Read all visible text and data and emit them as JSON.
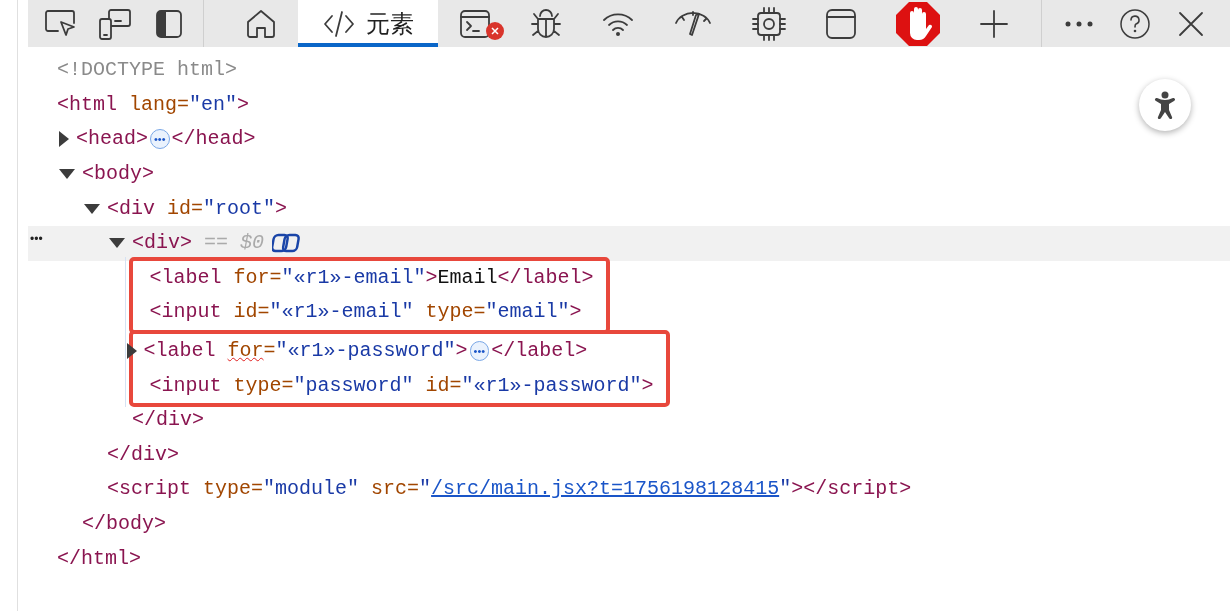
{
  "toolbar": {
    "left_tools": [
      {
        "kind": "cursor"
      },
      {
        "kind": "devices"
      },
      {
        "kind": "panel"
      }
    ],
    "tabs": [
      {
        "kind": "home",
        "selected": false
      },
      {
        "kind": "code",
        "label": "元素",
        "selected": true
      },
      {
        "kind": "terminal",
        "selected": false,
        "error_badge": true
      },
      {
        "kind": "bug",
        "selected": false
      },
      {
        "kind": "wifi",
        "selected": false
      },
      {
        "kind": "gauge",
        "selected": false
      },
      {
        "kind": "chip",
        "selected": false
      },
      {
        "kind": "window",
        "selected": false
      },
      {
        "kind": "stop_hand",
        "selected": false
      },
      {
        "kind": "plus",
        "selected": false
      }
    ],
    "actions": [
      {
        "kind": "more"
      },
      {
        "kind": "help"
      },
      {
        "kind": "close"
      }
    ]
  },
  "dom_tree": [
    {
      "tokens": [
        {
          "kind": "doctype",
          "text": "<!DOCTYPE html>"
        }
      ]
    },
    {
      "tokens": [
        {
          "kind": "tag",
          "text": "<html"
        },
        {
          "kind": "attr",
          "text": " lang="
        },
        {
          "kind": "value",
          "text": "\"en\""
        },
        {
          "kind": "tag",
          "text": ">"
        }
      ],
      "close_tokens": [
        {
          "kind": "tag",
          "text": "</html>"
        }
      ],
      "children": [
        {
          "expanded": false,
          "tokens": [
            {
              "kind": "tag",
              "text": "<head>"
            },
            {
              "kind": "collapsed",
              "text": "•••"
            },
            {
              "kind": "tag",
              "text": "</head>"
            }
          ]
        },
        {
          "expanded": true,
          "tokens": [
            {
              "kind": "tag",
              "text": "<body>"
            }
          ],
          "close_tokens": [
            {
              "kind": "tag",
              "text": "</body>"
            }
          ],
          "children": [
            {
              "expanded": true,
              "tokens": [
                {
                  "kind": "tag",
                  "text": "<div"
                },
                {
                  "kind": "attr",
                  "text": " id="
                },
                {
                  "kind": "value",
                  "text": "\"root\""
                },
                {
                  "kind": "tag",
                  "text": ">"
                }
              ],
              "close_tokens": [
                {
                  "kind": "tag",
                  "text": "</div>"
                }
              ],
              "children": [
                {
                  "expanded": true,
                  "selected": true,
                  "row_menu": "•••",
                  "tokens": [
                    {
                      "kind": "tag",
                      "text": "<div>"
                    },
                    {
                      "kind": "dim",
                      "text": " == $0"
                    },
                    {
                      "kind": "copilot_icon"
                    }
                  ],
                  "close_tokens": [
                    {
                      "kind": "tag",
                      "text": "</div>"
                    }
                  ],
                  "children": [
                    {
                      "kind": "outline",
                      "children": [
                        {
                          "tokens": [
                            {
                              "kind": "tag",
                              "text": "<label"
                            },
                            {
                              "kind": "attr",
                              "text": " for="
                            },
                            {
                              "kind": "value",
                              "text": "\"«r1»-email\""
                            },
                            {
                              "kind": "tag",
                              "text": ">"
                            },
                            {
                              "kind": "text",
                              "text": "Email"
                            },
                            {
                              "kind": "tag",
                              "text": "</label>"
                            }
                          ]
                        },
                        {
                          "tokens": [
                            {
                              "kind": "tag",
                              "text": "<input"
                            },
                            {
                              "kind": "attr",
                              "text": " id="
                            },
                            {
                              "kind": "value",
                              "text": "\"«r1»-email\""
                            },
                            {
                              "kind": "attr",
                              "text": " type="
                            },
                            {
                              "kind": "value",
                              "text": "\"email\""
                            },
                            {
                              "kind": "tag",
                              "text": ">"
                            }
                          ]
                        }
                      ]
                    },
                    {
                      "kind": "outline",
                      "children": [
                        {
                          "expanded": false,
                          "tokens": [
                            {
                              "kind": "tag",
                              "text": "<label "
                            },
                            {
                              "kind": "attr_misspelled",
                              "text": "for"
                            },
                            {
                              "kind": "attr",
                              "text": "="
                            },
                            {
                              "kind": "value",
                              "text": "\"«r1»-password\""
                            },
                            {
                              "kind": "tag",
                              "text": ">"
                            },
                            {
                              "kind": "collapsed",
                              "text": "•••"
                            },
                            {
                              "kind": "tag",
                              "text": "</label>"
                            }
                          ]
                        },
                        {
                          "tokens": [
                            {
                              "kind": "tag",
                              "text": "<input"
                            },
                            {
                              "kind": "attr",
                              "text": " type="
                            },
                            {
                              "kind": "value",
                              "text": "\"password\""
                            },
                            {
                              "kind": "attr",
                              "text": " id="
                            },
                            {
                              "kind": "value",
                              "text": "\"«r1»-password\""
                            },
                            {
                              "kind": "tag",
                              "text": ">"
                            }
                          ]
                        }
                      ]
                    }
                  ]
                }
              ]
            },
            {
              "tokens": [
                {
                  "kind": "tag",
                  "text": "<script"
                },
                {
                  "kind": "attr",
                  "text": " type="
                },
                {
                  "kind": "value",
                  "text": "\"module\""
                },
                {
                  "kind": "attr",
                  "text": " src="
                },
                {
                  "kind": "value",
                  "text": "\""
                },
                {
                  "kind": "link",
                  "text": "/src/main.jsx?t=1756198128415"
                },
                {
                  "kind": "value",
                  "text": "\""
                },
                {
                  "kind": "tag",
                  "text": "></script>"
                }
              ]
            }
          ]
        }
      ]
    }
  ],
  "floating_button": {
    "kind": "accessibility"
  }
}
